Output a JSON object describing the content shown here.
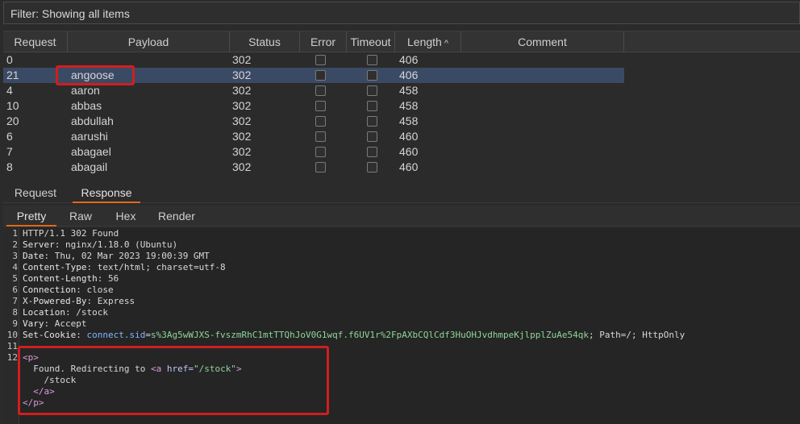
{
  "filter": {
    "text": "Filter: Showing all items"
  },
  "table": {
    "columns": [
      "Request",
      "Payload",
      "Status",
      "Error",
      "Timeout",
      "Length",
      "Comment"
    ],
    "sort_indicator": "^",
    "rows": [
      {
        "request": "0",
        "payload": "",
        "status": "302",
        "length": "406"
      },
      {
        "request": "21",
        "payload": "angoose",
        "status": "302",
        "length": "406",
        "selected": true
      },
      {
        "request": "4",
        "payload": "aaron",
        "status": "302",
        "length": "458"
      },
      {
        "request": "10",
        "payload": "abbas",
        "status": "302",
        "length": "458"
      },
      {
        "request": "20",
        "payload": "abdullah",
        "status": "302",
        "length": "458"
      },
      {
        "request": "6",
        "payload": "aarushi",
        "status": "302",
        "length": "460"
      },
      {
        "request": "7",
        "payload": "abagael",
        "status": "302",
        "length": "460"
      },
      {
        "request": "8",
        "payload": "abagail",
        "status": "302",
        "length": "460"
      }
    ]
  },
  "tabs_main": [
    "Request",
    "Response"
  ],
  "tabs_main_active": "Response",
  "tabs_view": [
    "Pretty",
    "Raw",
    "Hex",
    "Render"
  ],
  "tabs_view_active": "Pretty",
  "response": {
    "line_numbers": [
      "1",
      "2",
      "3",
      "4",
      "5",
      "6",
      "7",
      "8",
      "9",
      "10",
      "11",
      "12"
    ],
    "status_line": "HTTP/1.1 302 Found",
    "headers": [
      {
        "name": "Server",
        "value": "nginx/1.18.0 (Ubuntu)"
      },
      {
        "name": "Date",
        "value": "Thu, 02 Mar 2023 19:00:39 GMT"
      },
      {
        "name": "Content-Type",
        "value": "text/html; charset=utf-8"
      },
      {
        "name": "Content-Length",
        "value": "56"
      },
      {
        "name": "Connection",
        "value": "close"
      },
      {
        "name": "X-Powered-By",
        "value": "Express"
      },
      {
        "name": "Location",
        "value": "/stock"
      },
      {
        "name": "Vary",
        "value": "Accept"
      }
    ],
    "set_cookie": {
      "header": "Set-Cookie",
      "name": "connect.sid",
      "value": "s%3Ag5wWJXS-fvszmRhC1mtTTQhJoV0G1wqf.f6UV1r%2FpAXbCQlCdf3HuOHJvdhmpeKjlpplZuAe54qk",
      "rest": "; Path=/; HttpOnly"
    },
    "body": {
      "p_open": "<p>",
      "text": "Found. Redirecting to ",
      "a_open_tag": "<a",
      "href_attr": "href=",
      "href_value": "\"/stock\"",
      "a_open_close": ">",
      "link_text": "/stock",
      "a_close": "</a>",
      "p_close": "</p>"
    }
  },
  "colors": {
    "selected_row": "#3b4a64",
    "highlight_box": "#d11e1e",
    "active_tab_underline": "#e06a1a"
  }
}
